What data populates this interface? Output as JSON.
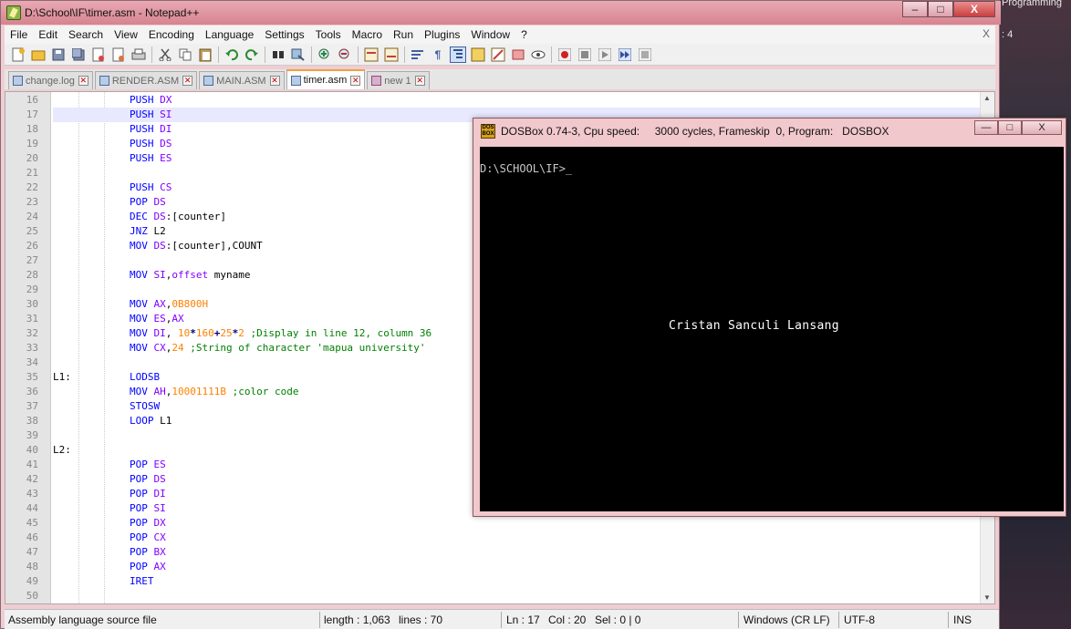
{
  "desktop": {
    "bg_text_top": "Programming",
    "bg_text_mid": ": 4"
  },
  "window": {
    "title": "D:\\School\\IF\\timer.asm - Notepad++",
    "minimize": "–",
    "maximize": "□",
    "close": "X"
  },
  "menu": {
    "items": [
      "File",
      "Edit",
      "Search",
      "View",
      "Encoding",
      "Language",
      "Settings",
      "Tools",
      "Macro",
      "Run",
      "Plugins",
      "Window",
      "?"
    ],
    "close": "X"
  },
  "tabs": [
    {
      "label": "change.log",
      "active": false
    },
    {
      "label": "RENDER.ASM",
      "active": false
    },
    {
      "label": "MAIN.ASM",
      "active": false
    },
    {
      "label": "timer.asm",
      "active": true
    },
    {
      "label": "new 1",
      "active": false
    }
  ],
  "editor": {
    "current_line": 17,
    "lines": [
      {
        "n": "16",
        "label": "",
        "kw": "PUSH",
        "args": " DX"
      },
      {
        "n": "17",
        "label": "",
        "kw": "PUSH",
        "args": " SI"
      },
      {
        "n": "18",
        "label": "",
        "kw": "PUSH",
        "args": " DI"
      },
      {
        "n": "19",
        "label": "",
        "kw": "PUSH",
        "args": " DS"
      },
      {
        "n": "20",
        "label": "",
        "kw": "PUSH",
        "args": " ES"
      },
      {
        "n": "21",
        "label": "",
        "kw": "",
        "args": ""
      },
      {
        "n": "22",
        "label": "",
        "kw": "PUSH",
        "args": " CS"
      },
      {
        "n": "23",
        "label": "",
        "kw": "POP",
        "args": " DS"
      },
      {
        "n": "24",
        "label": "",
        "kw": "DEC",
        "args": " DS:[counter]"
      },
      {
        "n": "25",
        "label": "",
        "kw": "JNZ",
        "args": " L2"
      },
      {
        "n": "26",
        "label": "",
        "kw": "MOV",
        "args": " DS:[counter],COUNT"
      },
      {
        "n": "27",
        "label": "",
        "kw": "",
        "args": ""
      },
      {
        "n": "28",
        "label": "",
        "kw": "MOV",
        "args": " SI,offset myname"
      },
      {
        "n": "29",
        "label": "",
        "kw": "",
        "args": ""
      },
      {
        "n": "30",
        "label": "",
        "kw": "MOV",
        "args": " AX,0B800H"
      },
      {
        "n": "31",
        "label": "",
        "kw": "MOV",
        "args": " ES,AX"
      },
      {
        "n": "32",
        "label": "",
        "kw": "MOV",
        "args": " DI, 10*160+25*2 ;Display in line 12, column 36"
      },
      {
        "n": "33",
        "label": "",
        "kw": "MOV",
        "args": " CX,24 ;String of character 'mapua university'"
      },
      {
        "n": "34",
        "label": "",
        "kw": "",
        "args": ""
      },
      {
        "n": "35",
        "label": "L1:",
        "kw": "LODSB",
        "args": ""
      },
      {
        "n": "36",
        "label": "",
        "kw": "MOV",
        "args": " AH,10001111B ;color code"
      },
      {
        "n": "37",
        "label": "",
        "kw": "STOSW",
        "args": ""
      },
      {
        "n": "38",
        "label": "",
        "kw": "LOOP",
        "args": " L1"
      },
      {
        "n": "39",
        "label": "",
        "kw": "",
        "args": ""
      },
      {
        "n": "40",
        "label": "L2:",
        "kw": "",
        "args": ""
      },
      {
        "n": "41",
        "label": "",
        "kw": "POP",
        "args": " ES"
      },
      {
        "n": "42",
        "label": "",
        "kw": "POP",
        "args": " DS"
      },
      {
        "n": "43",
        "label": "",
        "kw": "POP",
        "args": " DI"
      },
      {
        "n": "44",
        "label": "",
        "kw": "POP",
        "args": " SI"
      },
      {
        "n": "45",
        "label": "",
        "kw": "POP",
        "args": " DX"
      },
      {
        "n": "46",
        "label": "",
        "kw": "POP",
        "args": " CX"
      },
      {
        "n": "47",
        "label": "",
        "kw": "POP",
        "args": " BX"
      },
      {
        "n": "48",
        "label": "",
        "kw": "POP",
        "args": " AX"
      },
      {
        "n": "49",
        "label": "",
        "kw": "IRET",
        "args": ""
      },
      {
        "n": "50",
        "label": "",
        "kw": "",
        "args": ""
      }
    ]
  },
  "status": {
    "language": "Assembly language source file",
    "length": "length : 1,063",
    "lines": "lines : 70",
    "ln": "Ln : 17",
    "col": "Col : 20",
    "sel": "Sel : 0 | 0",
    "eol": "Windows (CR LF)",
    "encoding": "UTF-8",
    "mode": "INS"
  },
  "dosbox": {
    "icon_text": "DOS BOX",
    "title": "DOSBox 0.74-3, Cpu speed:     3000 cycles, Frameskip  0, Program:   DOSBOX",
    "minimize": "—",
    "maximize": "□",
    "close": "X",
    "prompt": "D:\\SCHOOL\\IF>_",
    "output_name": "Cristan Sanculi Lansang"
  },
  "colors": {
    "keyword": "#0000ff",
    "register": "#8000ff",
    "number": "#ff8000",
    "comment": "#008000",
    "title_bar": "#e9a9b4"
  }
}
